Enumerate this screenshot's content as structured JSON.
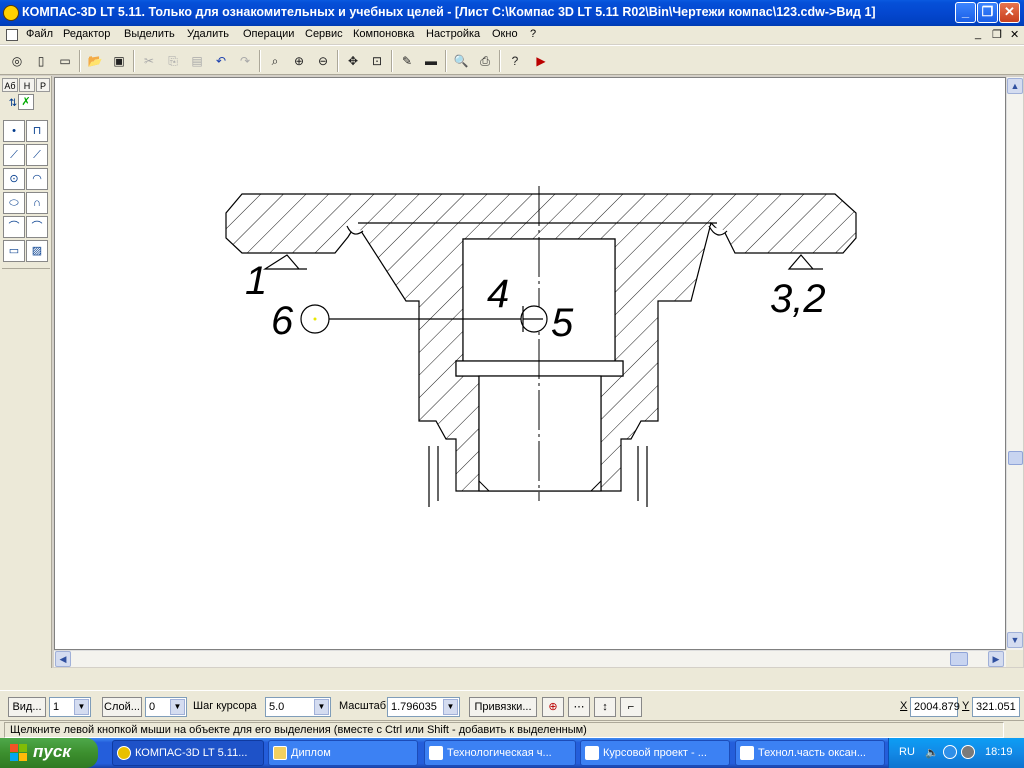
{
  "window": {
    "title": "КОМПАС-3D LT 5.11. Только для ознакомительных и учебных целей - [Лист C:\\Компас 3D LT 5.11 R02\\Bin\\Чертежи компас\\123.cdw->Вид 1]"
  },
  "menu": {
    "items": [
      "Файл",
      "Редактор",
      "Выделить",
      "Удалить",
      "Операции",
      "Сервис",
      "Компоновка",
      "Настройка",
      "Окно",
      "?"
    ]
  },
  "left_panel": {
    "tabs": [
      "Aб",
      "H",
      "P"
    ]
  },
  "drawing": {
    "labels": {
      "l1": "1",
      "l32": "3,2",
      "l4": "4",
      "l5": "5",
      "l6": "6"
    }
  },
  "status": {
    "view_button": "Вид...",
    "view_value": "1",
    "layer_button": "Слой...",
    "layer_value": "0",
    "step_label": "Шаг курсора",
    "step_value": "5.0",
    "scale_label": "Масштаб",
    "scale_value": "1.796035",
    "snaps_button": "Привязки...",
    "x_label": "X",
    "x_value": "2004.879",
    "y_label": "Y",
    "y_value": "321.051"
  },
  "hint": "Щелкните левой кнопкой мыши на объекте для его выделения (вместе с Ctrl или Shift - добавить к выделенным)",
  "taskbar": {
    "start": "пуск",
    "tasks": [
      "КОМПАС-3D LT 5.11...",
      "Диплом",
      "Технологическая ч...",
      "Курсовой проект - ...",
      "Технол.часть оксан..."
    ],
    "lang": "RU",
    "clock": "18:19"
  },
  "colors": {
    "titlebar": "#0447cf",
    "taskbar": "#245edb",
    "start": "#3c8f2e",
    "canvas": "#ffffff"
  }
}
